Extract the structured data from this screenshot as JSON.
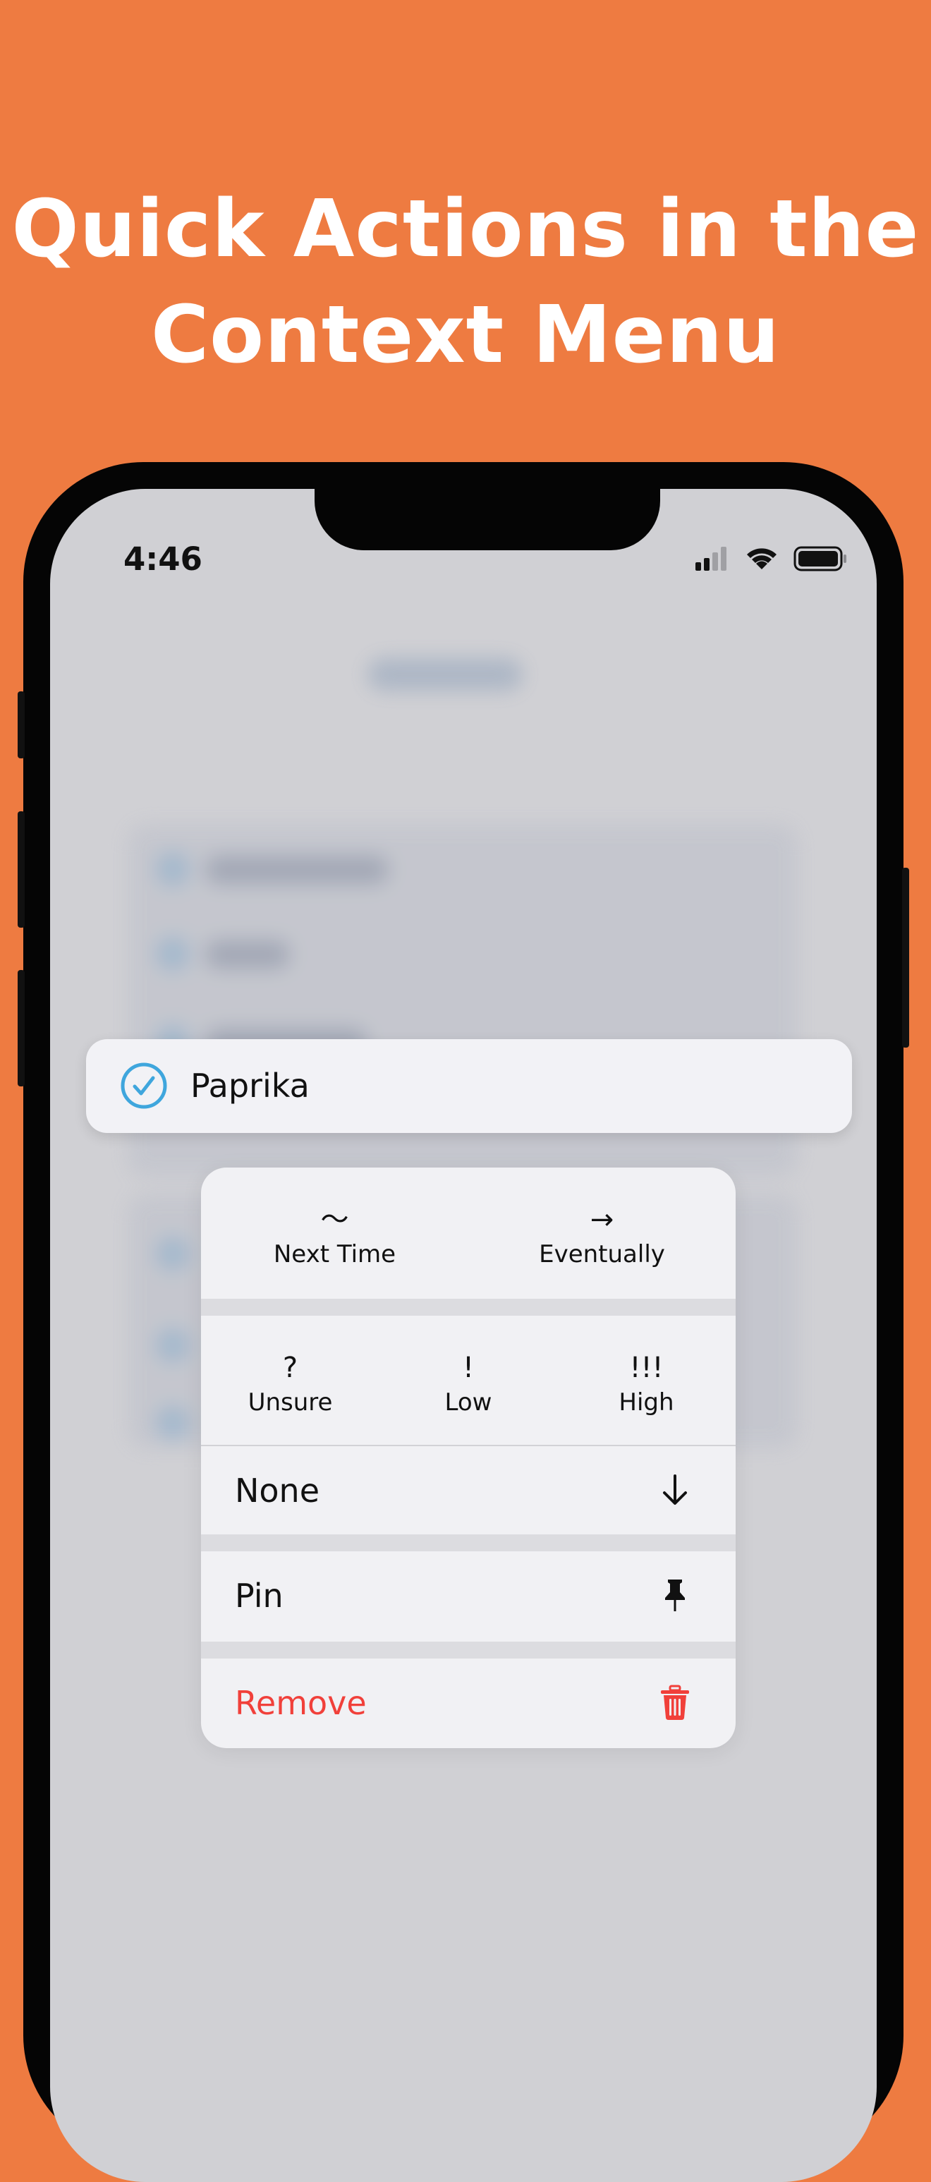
{
  "headline": {
    "line1": "Quick Actions in the",
    "line2": "Context Menu"
  },
  "status_bar": {
    "time": "4:46",
    "icons": [
      "cellular-signal-icon",
      "wifi-icon",
      "battery-icon"
    ]
  },
  "item": {
    "label": "Paprika",
    "icon": "checkmark-circle-icon"
  },
  "context_menu": {
    "timing_actions": [
      {
        "glyph": "～",
        "label": "Next Time"
      },
      {
        "glyph": "→",
        "label": "Eventually"
      }
    ],
    "priority_actions": [
      {
        "glyph": "?",
        "label": "Unsure"
      },
      {
        "glyph": "!",
        "label": "Low"
      },
      {
        "glyph": "!!!",
        "label": "High"
      }
    ],
    "none_label": "None",
    "pin_label": "Pin",
    "remove_label": "Remove"
  },
  "colors": {
    "background": "#EE7B41",
    "accent_blue": "#3FA6DD",
    "destructive_red": "#F1403A",
    "menu_bg": "#F1F1F4"
  }
}
